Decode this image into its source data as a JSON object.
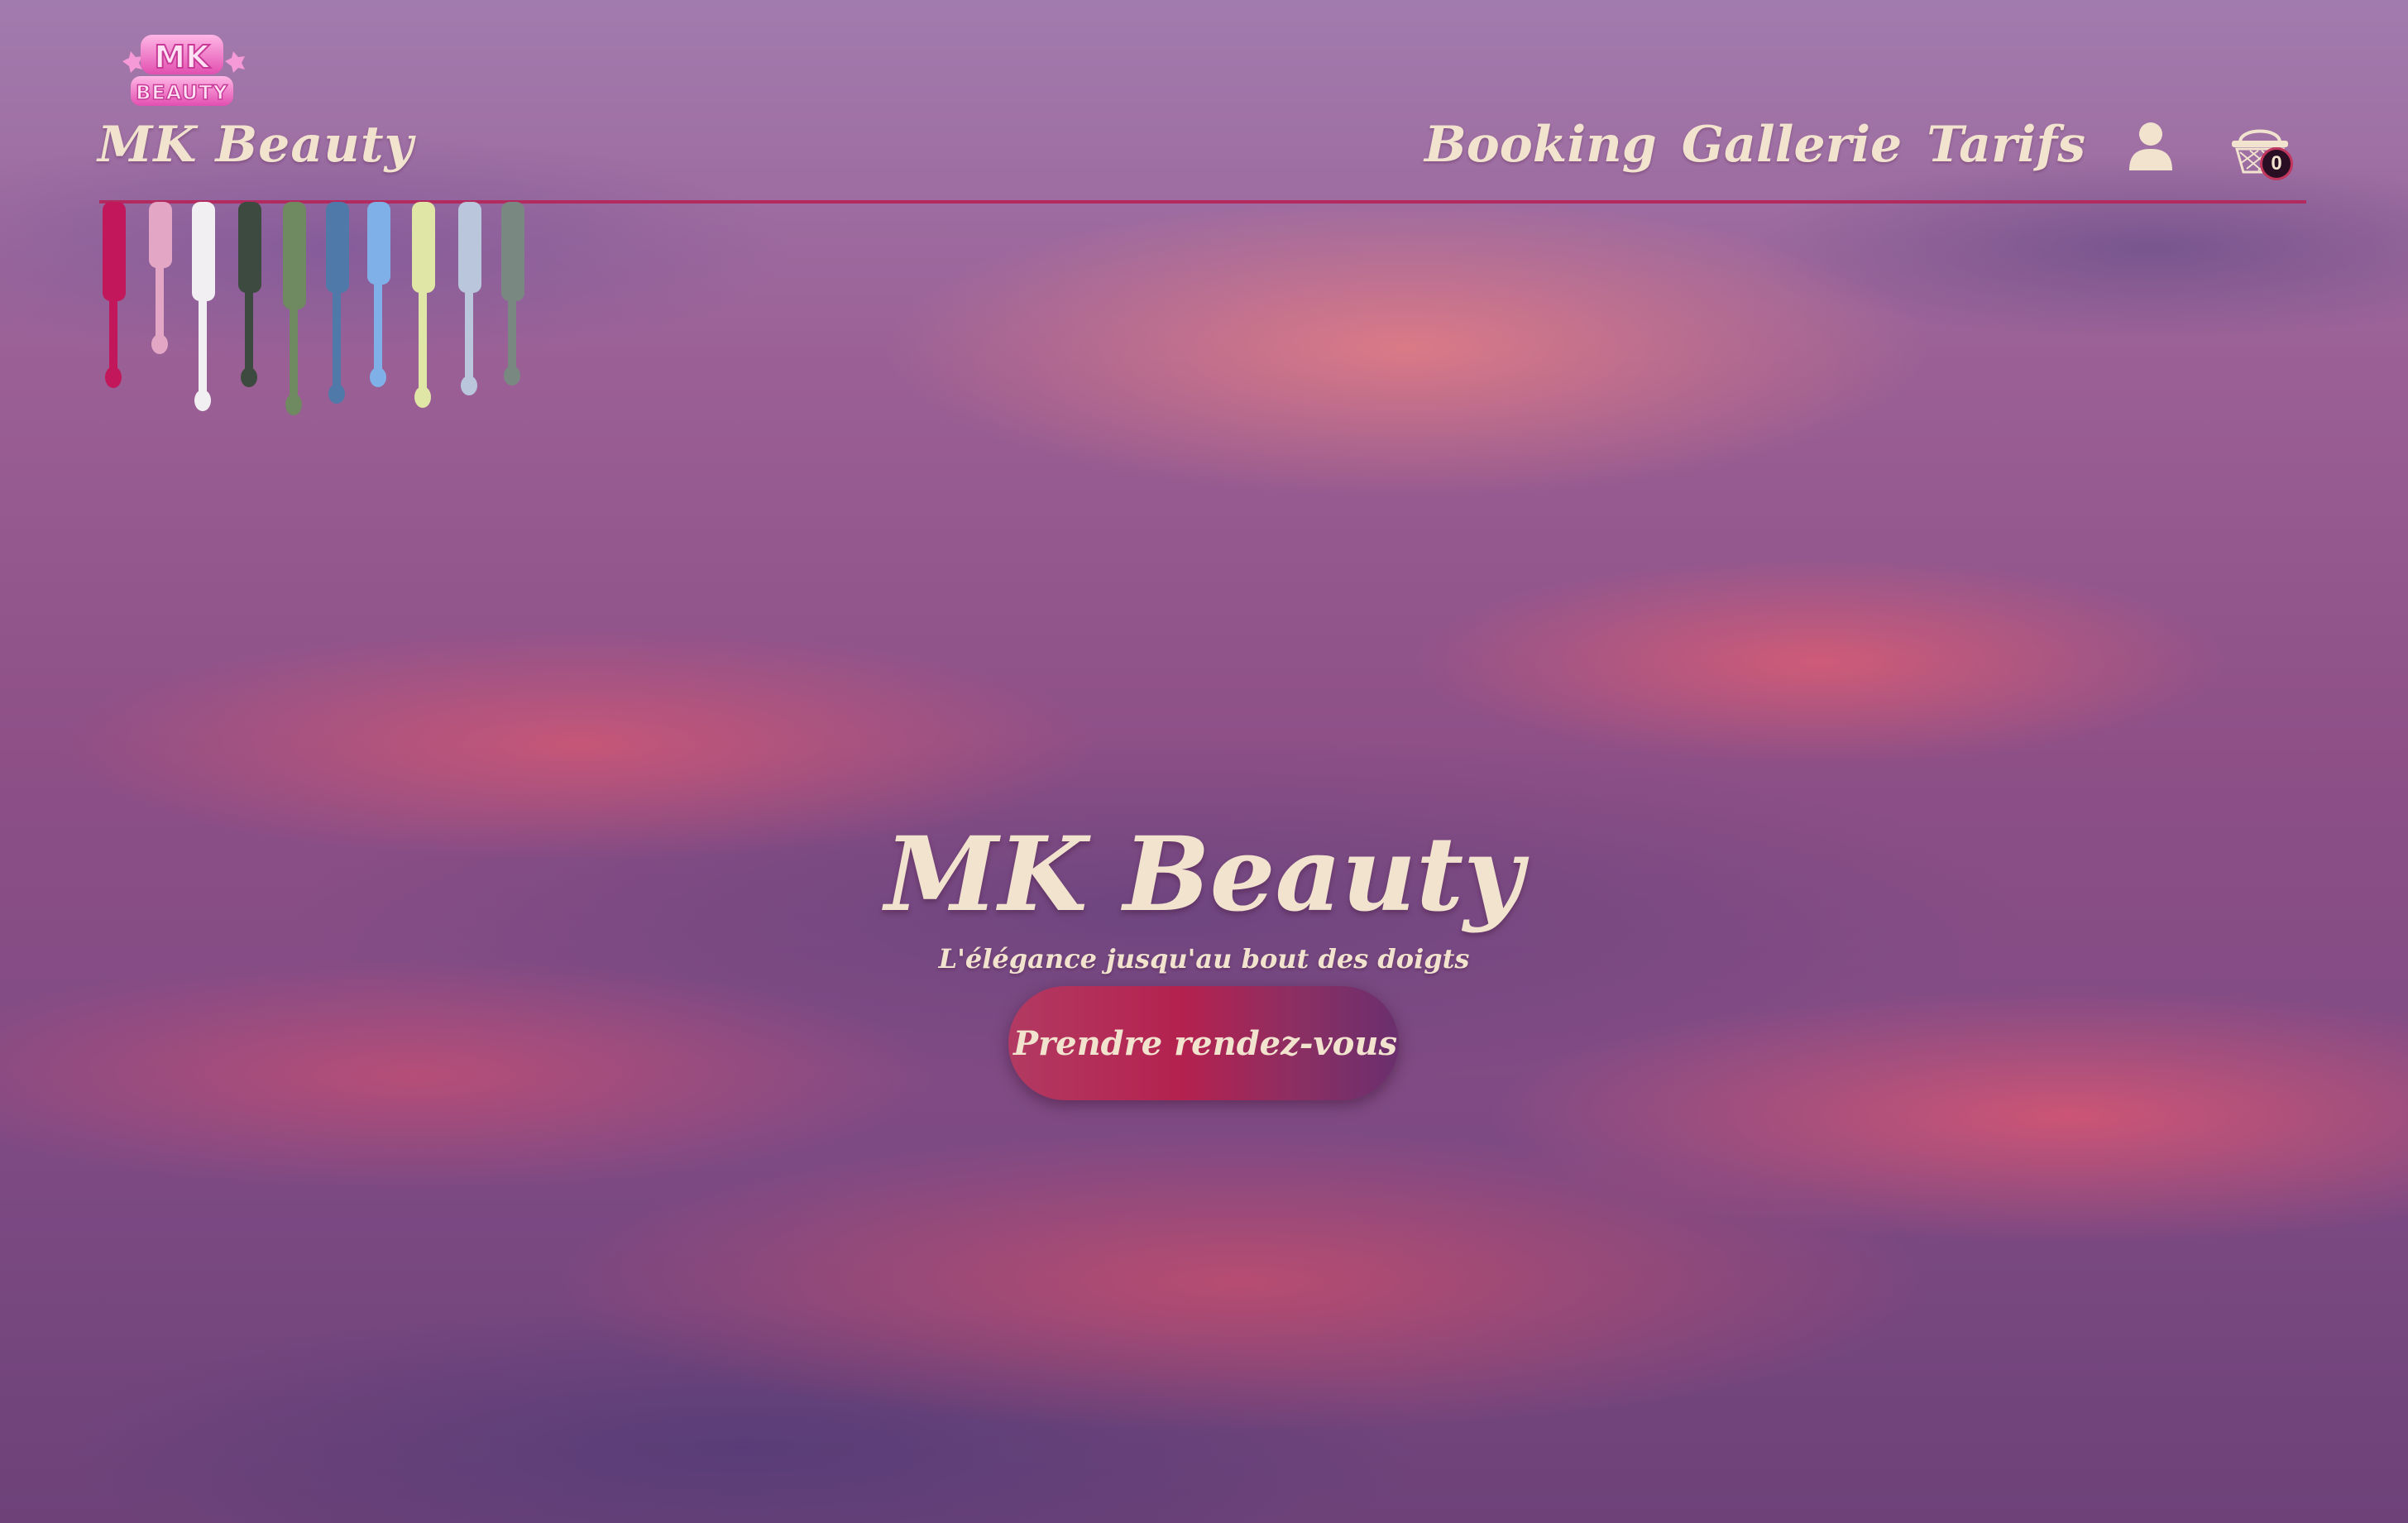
{
  "header": {
    "logo_alt": "MK Beauty",
    "brand_name": "MK Beauty",
    "nav": [
      {
        "label": "Booking"
      },
      {
        "label": "Gallerie"
      },
      {
        "label": "Tarifs"
      }
    ],
    "user_icon": "user-icon",
    "cart_icon": "basket-icon",
    "cart_count": "0"
  },
  "hero": {
    "title": "MK Beauty",
    "tagline": "L'élégance jusqu'au bout des doigts",
    "cta_label": "Prendre rendez-vous"
  },
  "colors": {
    "text": "#f2e3cf",
    "accent": "#b4214f",
    "divider": "#b32a5f",
    "logo_pink": "#ee7ec7"
  },
  "polish_colors": [
    "#c2185b",
    "#e3a6c4",
    "#f2eff2",
    "#3d4a3f",
    "#6f8a60",
    "#4f79a8",
    "#7fb1e8",
    "#dfe6a6",
    "#b9c6dc",
    "#7a8882"
  ]
}
